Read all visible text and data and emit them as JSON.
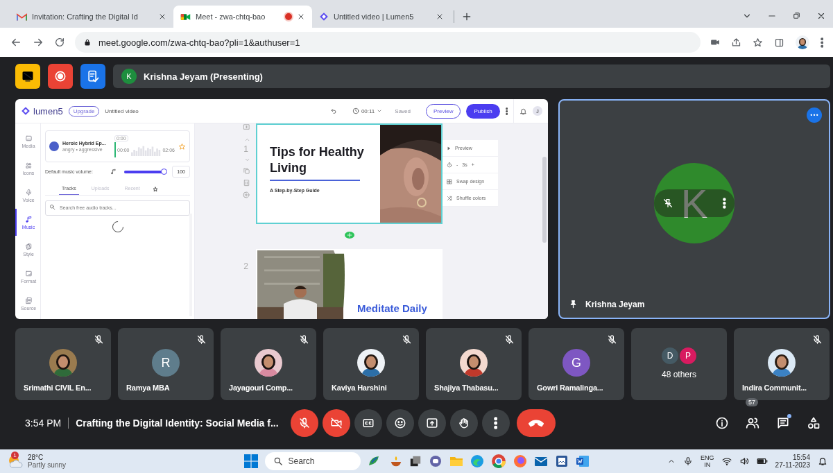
{
  "browser": {
    "tabs": [
      {
        "title": "Invitation: Crafting the Digital Id",
        "kind": "mail",
        "selected": false,
        "recording": false
      },
      {
        "title": "Meet - zwa-chtq-bao",
        "kind": "meet",
        "selected": true,
        "recording": true
      },
      {
        "title": "Untitled video | Lumen5",
        "kind": "lumen",
        "selected": false,
        "recording": false
      }
    ],
    "url": "meet.google.com/zwa-chtq-bao?pli=1&authuser=1"
  },
  "meet": {
    "presenter": {
      "initial": "K",
      "label": "Krishna Jeyam (Presenting)"
    },
    "shared_screen": {
      "brand": "lumen5",
      "upgrade": "Upgrade",
      "doc_title": "Untitled video",
      "duration": "00:11",
      "save_status": "Saved",
      "preview": "Preview",
      "publish": "Publish",
      "user_initial": "J",
      "sidebar": [
        {
          "label": "Media",
          "selected": false
        },
        {
          "label": "Icons",
          "selected": false
        },
        {
          "label": "Voice",
          "selected": false
        },
        {
          "label": "Music",
          "selected": true
        },
        {
          "label": "Style",
          "selected": false
        },
        {
          "label": "Format",
          "selected": false
        },
        {
          "label": "Source",
          "selected": false
        }
      ],
      "track": {
        "title": "Heroic Hybrid Ep...",
        "tags": "angry • aggressive",
        "marker": "0:00",
        "start": "00:00",
        "end": "02:06"
      },
      "volume": {
        "label": "Default music volume:",
        "level": 1,
        "value": "100"
      },
      "tabs": [
        {
          "label": "Tracks",
          "selected": true
        },
        {
          "label": "Uploads",
          "selected": false
        },
        {
          "label": "Recent",
          "selected": false
        }
      ],
      "search": {
        "placeholder": "Search free audio tracks..."
      },
      "scenes": [
        {
          "number": "1",
          "kind": "title",
          "title": "Tips for Healthy Living",
          "subtitle": "A Step-by-Step Guide",
          "selected": true
        },
        {
          "number": "2",
          "title": "Meditate Daily",
          "selected": false
        }
      ],
      "scene_menu": {
        "preview": "Preview",
        "decrease": "-",
        "duration": "3s",
        "increase": "+",
        "swap": "Swap design",
        "shuffle": "Shuffle colors"
      }
    },
    "spotlight": {
      "initial": "K",
      "name": "Krishna Jeyam"
    },
    "participants": [
      {
        "name": "Srimathi CIVIL En...",
        "muted": true
      },
      {
        "name": "Ramya MBA",
        "kind": "initial",
        "initial": "R",
        "color": "#5f7d8c",
        "muted": true
      },
      {
        "name": "Jayagouri Comp...",
        "muted": true
      },
      {
        "name": "Kaviya Harshini",
        "muted": true
      },
      {
        "name": "Shajiya Thabasu...",
        "muted": true
      },
      {
        "name": "Gowri Ramalinga...",
        "kind": "initial",
        "initial": "G",
        "color": "#7e57c2",
        "muted": true
      },
      {
        "name": "48 others",
        "kind": "others",
        "muted": false,
        "avatars": [
          {
            "initial": "D",
            "color": "#455a64"
          },
          {
            "initial": "P",
            "color": "#d81b60"
          }
        ]
      },
      {
        "name": "Indira Communit...",
        "muted": true
      }
    ],
    "meeting_time": "3:54 PM",
    "meeting_title": "Crafting the Digital Identity: Social Media f...",
    "mic": {
      "on": false
    },
    "camera": {
      "on": false
    },
    "people_count": "57",
    "chat_unread": true
  },
  "taskbar": {
    "weather": {
      "temperature": "28°C",
      "condition": "Partly sunny",
      "badge": "1"
    },
    "search": "Search",
    "language": "ENG",
    "region": "IN",
    "time": "15:54",
    "date": "27-11-2023"
  }
}
